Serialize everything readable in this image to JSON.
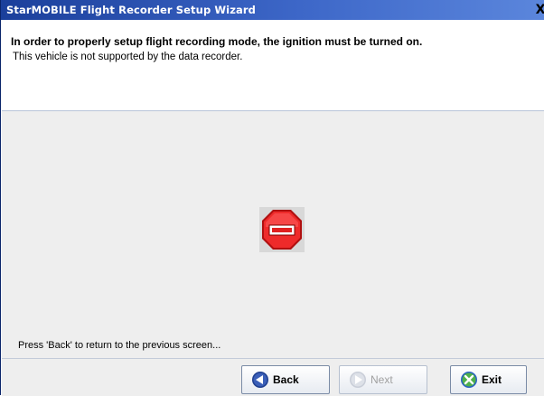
{
  "window": {
    "title": "StarMOBILE Flight Recorder Setup Wizard",
    "close_label": "X"
  },
  "header": {
    "title": "In order to properly setup flight recording mode, the ignition must be turned on.",
    "subtitle": "This vehicle is not supported by the data recorder."
  },
  "content": {
    "icon": "stop-sign-icon",
    "status": "Press 'Back' to return to the previous screen..."
  },
  "footer": {
    "back_label": "Back",
    "next_label": "Next",
    "exit_label": "Exit"
  },
  "colors": {
    "titlebar": "#2f58b8",
    "stop_sign": "#e02020",
    "background": "#eeeeee"
  }
}
